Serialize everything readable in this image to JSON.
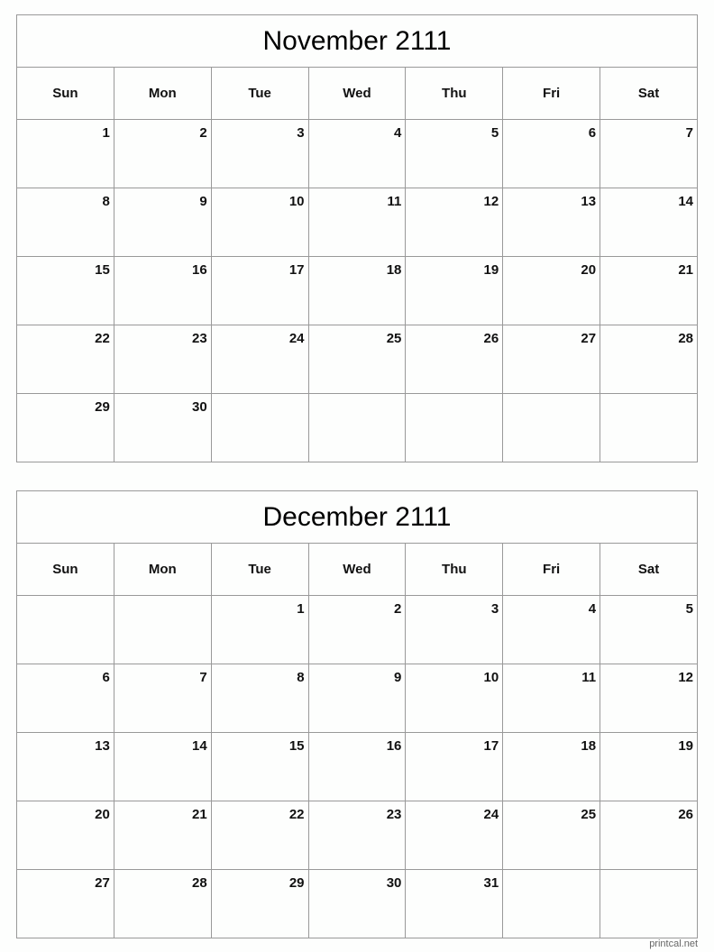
{
  "weekdays": [
    "Sun",
    "Mon",
    "Tue",
    "Wed",
    "Thu",
    "Fri",
    "Sat"
  ],
  "months": [
    {
      "title": "November 2111",
      "weeks": [
        [
          "1",
          "2",
          "3",
          "4",
          "5",
          "6",
          "7"
        ],
        [
          "8",
          "9",
          "10",
          "11",
          "12",
          "13",
          "14"
        ],
        [
          "15",
          "16",
          "17",
          "18",
          "19",
          "20",
          "21"
        ],
        [
          "22",
          "23",
          "24",
          "25",
          "26",
          "27",
          "28"
        ],
        [
          "29",
          "30",
          "",
          "",
          "",
          "",
          ""
        ]
      ]
    },
    {
      "title": "December 2111",
      "weeks": [
        [
          "",
          "",
          "1",
          "2",
          "3",
          "4",
          "5"
        ],
        [
          "6",
          "7",
          "8",
          "9",
          "10",
          "11",
          "12"
        ],
        [
          "13",
          "14",
          "15",
          "16",
          "17",
          "18",
          "19"
        ],
        [
          "20",
          "21",
          "22",
          "23",
          "24",
          "25",
          "26"
        ],
        [
          "27",
          "28",
          "29",
          "30",
          "31",
          "",
          ""
        ]
      ]
    }
  ],
  "footer": "printcal.net"
}
